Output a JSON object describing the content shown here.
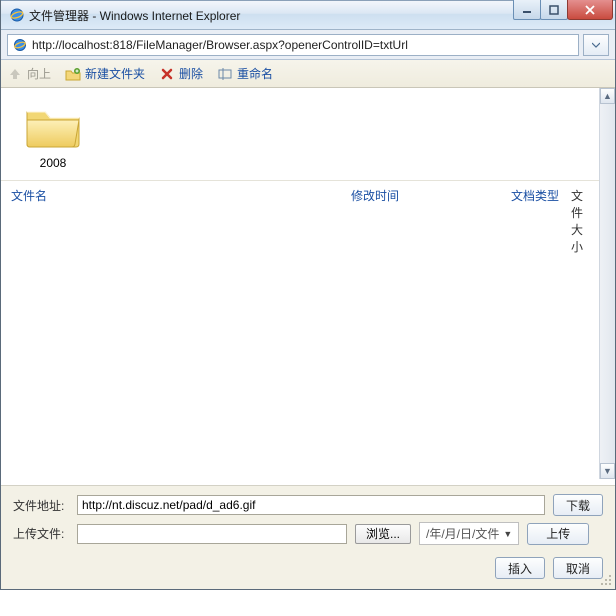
{
  "window": {
    "title": "文件管理器 - Windows Internet Explorer"
  },
  "address": {
    "url": "http://localhost:818/FileManager/Browser.aspx?openerControlID=txtUrl"
  },
  "toolbar": {
    "up": "向上",
    "new_folder": "新建文件夹",
    "delete": "删除",
    "rename": "重命名"
  },
  "folders": [
    {
      "name": "2008"
    }
  ],
  "list_header": {
    "name": "文件名",
    "mtime": "修改时间",
    "type": "文档类型",
    "size": "文件大小"
  },
  "bottom": {
    "file_addr_label": "文件地址:",
    "file_addr_value": "http://nt.discuz.net/pad/d_ad6.gif",
    "download": "下载",
    "upload_label": "上传文件:",
    "upload_value": "",
    "browse": "浏览...",
    "date_placeholder": "/年/月/日/文件",
    "upload": "上传",
    "insert": "插入",
    "cancel": "取消"
  }
}
